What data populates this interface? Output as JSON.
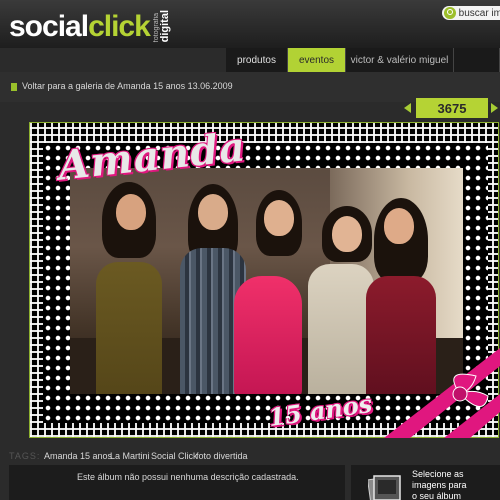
{
  "header": {
    "logo": {
      "part1": "social",
      "part2": "click",
      "tag_small": "fotografia",
      "tag_big": "digital"
    },
    "search_label": "buscar im"
  },
  "nav": {
    "tabs": [
      "produtos",
      "eventos",
      "victor & valério miguel"
    ],
    "active": "eventos"
  },
  "back_link": "Voltar para a galeria de Amanda 15 anos 13.06.2009",
  "counter": "3675",
  "photo": {
    "title_text": "Amanda",
    "subtitle_text": "15 anos"
  },
  "tags": {
    "label": "TAGS:",
    "items": [
      "Amanda 15 anos",
      "La Martini",
      "Social Click",
      "foto divertida"
    ]
  },
  "description": "Este álbum não possui nenhuma descrição cadastrada.",
  "select_prompt": [
    "Selecione as",
    "imagens para",
    "o seu álbum"
  ],
  "colors": {
    "accent": "#b5d334",
    "pink": "#e0177f",
    "background": "#2b2b2b"
  }
}
